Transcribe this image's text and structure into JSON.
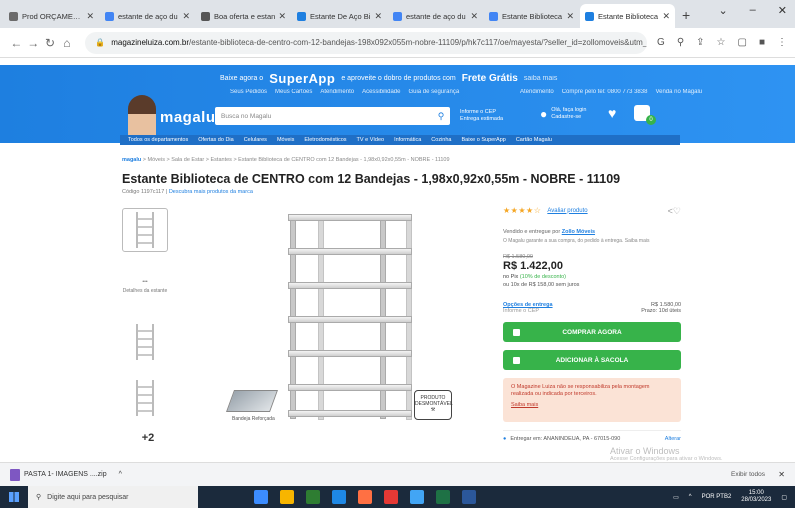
{
  "browser": {
    "tabs": [
      {
        "title": "Prod ORÇAMENTO",
        "color": "#6b6b6b"
      },
      {
        "title": "estante de aço du",
        "color": "#4285f4"
      },
      {
        "title": "Boa oferta e estan",
        "color": "#555555"
      },
      {
        "title": "Estante De Aço Bi",
        "color": "#1e7fe0"
      },
      {
        "title": "estante de aço du",
        "color": "#4285f4"
      },
      {
        "title": "Estante Biblioteca",
        "color": "#4285f4"
      },
      {
        "title": "Estante Biblioteca",
        "color": "#1e7fe0",
        "active": true
      }
    ],
    "new_tab": "+",
    "url_host": "magazineluiza.com.br",
    "url_path": "/estante-biblioteca-de-centro-com-12-bandejas-198x092x055m-nobre-11109/p/hk7c117/oe/mayesta/?seller_id=zollomoveis&utm_source=..."
  },
  "header": {
    "promo_pre": "Baixe agora o",
    "superapp": "SuperApp",
    "promo_mid": "e aproveite o dobro de produtos com",
    "frete": "Frete Grátis",
    "promo_link": "saiba mais",
    "subnav_left": [
      "Seus Pedidos",
      "Meus Cartões",
      "Atendimento",
      "Acessibilidade",
      "Guia de segurança"
    ],
    "subnav_right": [
      "Atendimento",
      "Compre pelo tel: 0800 773 3838",
      "Venda no Magalu"
    ],
    "logo": "magalu",
    "search_placeholder": "Busca no Magalu",
    "cep_label": "Informe o CEP",
    "cep_sub": "Entrega estimada",
    "account_label": "Olá, faça login",
    "account_sub": "Cadastre-se",
    "cart_count": "0",
    "categories": [
      "Todos os departamentos",
      "Ofertas do Dia",
      "Celulares",
      "Móveis",
      "Eletrodomésticos",
      "TV e Vídeo",
      "Informática",
      "Cozinha",
      "Baixe o SuperApp",
      "Cartão Magalu"
    ]
  },
  "product": {
    "breadcrumb_home": "magalu",
    "breadcrumb_path": "> Móveis > Sala de Estar > Estantes > Estante Biblioteca de CENTRO com 12 Bandejas - 1,98x0,92x0,55m - NOBRE - 11109",
    "title": "Estante Biblioteca de CENTRO com 12 Bandejas - 1,98x0,92x0,55m - NOBRE - 11109",
    "subtitle_code": "Código 1197c117",
    "subtitle_link": "Descubra mais produtos da marca",
    "more_images": "+2",
    "thumb_text": "Detalhes da estante",
    "demo_caption": "Bandeja Reforçada",
    "stamp_text": "PRODUTO DESMONTÁVEL",
    "rating_stars": "★★★★☆",
    "rating_link": "Avaliar produto",
    "share_icon": "share-icon",
    "seller_prefix": "Vendido e entregue por",
    "seller_name": "Zollo Móveis",
    "seller_note": "O Magalu garante a sua compra, do pedido à entrega. Saiba mais",
    "old_price": "R$ 1.580,00",
    "price": "R$ 1.422,00",
    "pix_text": "no Pix",
    "pix_discount": "(10% de desconto)",
    "installments": "ou 10x de R$ 158,00 sem juros",
    "shipping_label": "Opções de entrega",
    "shipping_sub": "Informe o CEP",
    "shipping_right_1": "R$ 1.580,00",
    "shipping_right_2": "Prazo: 10d úteis",
    "buy_button": "COMPRAR AGORA",
    "cart_button": "ADICIONAR À SACOLA",
    "warning_text": "O Magazine Luiza não se responsabiliza pela montagem realizada ou indicada por terceiros.",
    "warning_more": "Saiba mais",
    "location_text": "Entregar em: ANANINDEUA, PA - 67015-090",
    "location_alt": "Alterar"
  },
  "watermark": {
    "line1": "Ativar o Windows",
    "line2": "Acesse Configurações para ativar o Windows."
  },
  "downloads": {
    "file": "PASTA 1- IMAGENS ....zip",
    "show_all": "Exibir todos"
  },
  "taskbar": {
    "search_placeholder": "Digite aqui para pesquisar",
    "lang": "POR PTB2",
    "time": "15:00",
    "date": "28/03/2023",
    "app_colors": [
      "#3c8cff",
      "#f7b500",
      "#2e7d32",
      "#1e88e5",
      "#ff7043",
      "#e53935",
      "#42a5f5",
      "#1e7145",
      "#2b579a"
    ]
  }
}
